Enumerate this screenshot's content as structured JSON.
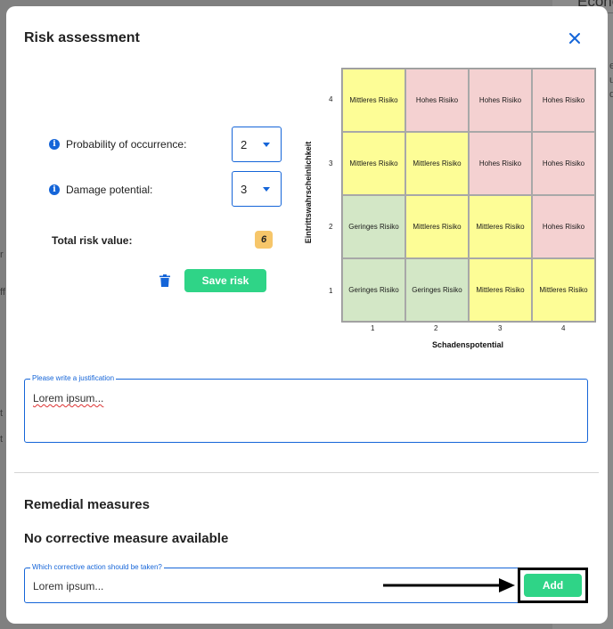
{
  "background": {
    "title_fragment": "Econo",
    "side_fragments": [
      "r",
      "ff",
      "t",
      "t",
      "er",
      "ul",
      "d"
    ]
  },
  "modal": {
    "title": "Risk assessment",
    "close_icon": "close-icon"
  },
  "probability": {
    "label": "Probability of occurrence:",
    "value": "2"
  },
  "damage": {
    "label": "Damage potential:",
    "value": "3"
  },
  "total": {
    "label": "Total risk value:",
    "value": "6"
  },
  "actions": {
    "delete_icon": "trash-icon",
    "save_label": "Save risk"
  },
  "matrix": {
    "y_label": "Eintrittswahrscheinlichkeit",
    "x_label": "Schadenspotential",
    "y_ticks": [
      "4",
      "3",
      "2",
      "1"
    ],
    "x_ticks": [
      "1",
      "2",
      "3",
      "4"
    ],
    "rows": [
      [
        "Mittleres Risiko",
        "Hohes Risiko",
        "Hohes Risiko",
        "Hohes Risiko"
      ],
      [
        "Mittleres Risiko",
        "Mittleres Risiko",
        "Hohes Risiko",
        "Hohes Risiko"
      ],
      [
        "Geringes Risiko",
        "Mittleres Risiko",
        "Mittleres Risiko",
        "Hohes Risiko"
      ],
      [
        "Geringes Risiko",
        "Geringes Risiko",
        "Mittleres Risiko",
        "Mittleres Risiko"
      ]
    ],
    "levels": [
      [
        "mid",
        "high",
        "high",
        "high"
      ],
      [
        "mid",
        "mid",
        "high",
        "high"
      ],
      [
        "low",
        "mid",
        "mid",
        "high"
      ],
      [
        "low",
        "low",
        "mid",
        "mid"
      ]
    ],
    "colors": {
      "low": "#d3e7c6",
      "mid": "#fdfd96",
      "high": "#f4d1d1"
    }
  },
  "justification": {
    "legend": "Please write a justification",
    "value": "Lorem ipsum..."
  },
  "remedial": {
    "title": "Remedial measures",
    "empty_note": "No corrective measure available",
    "input_legend": "Which corrective action should be taken?",
    "input_value": "Lorem ipsum...",
    "add_label": "Add"
  },
  "colors": {
    "accent": "#1565d8",
    "success": "#2fd487",
    "badge": "#f6c66a"
  }
}
